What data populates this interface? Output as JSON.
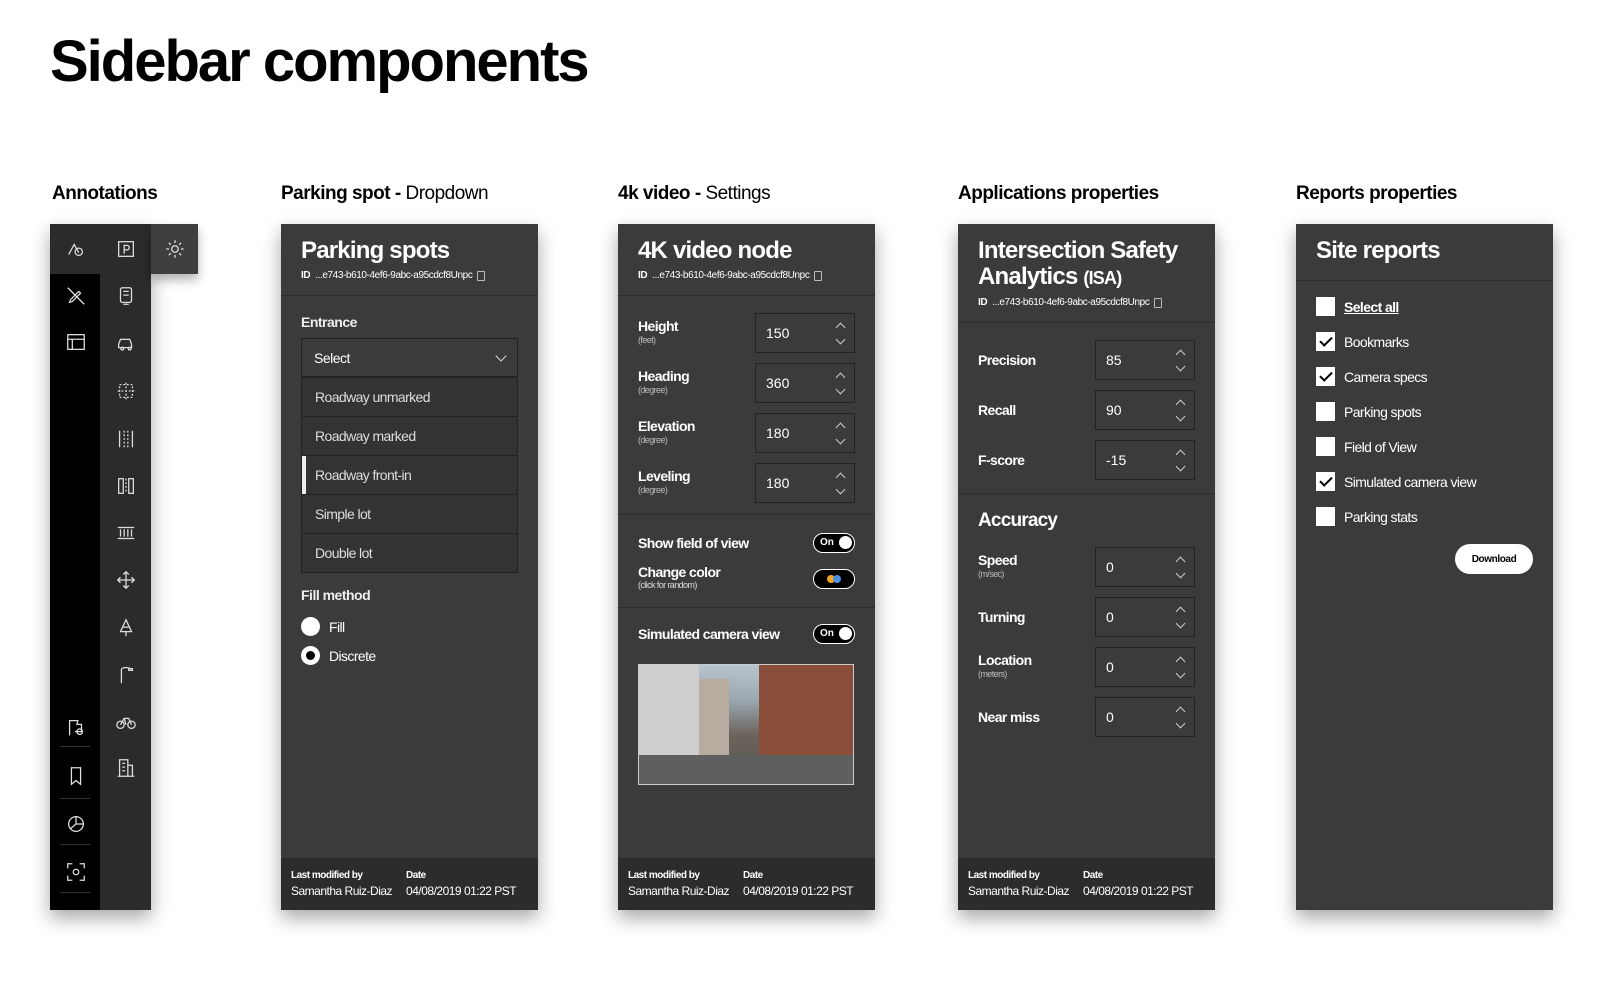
{
  "page": {
    "title": "Sidebar components"
  },
  "sections": {
    "annotations": "Annotations",
    "parking_bold": "Parking spot -",
    "parking_light": "Dropdown",
    "video_bold": "4k video -",
    "video_light": "Settings",
    "apps": "Applications properties",
    "reports": "Reports properties"
  },
  "annotations_bar": {
    "col1_icons": [
      "shapes-icon",
      "pen-off-icon",
      "layout-icon",
      "map-marker-settings-icon",
      "bookmark-icon",
      "chart-pie-icon",
      "focus-frame-icon"
    ],
    "col2_icons": [
      "parking-icon",
      "sign-icon",
      "car-icon",
      "dashed-box-icon",
      "lanes-icon",
      "lane-divider-icon",
      "crosswalk-icon",
      "move-icon",
      "tree-icon",
      "streetlight-icon",
      "bicycle-icon",
      "building-icon"
    ],
    "gear_icon": "gear-icon"
  },
  "parking": {
    "title": "Parking spots",
    "id_label": "ID",
    "id_value": "...e743-b610-4ef6-9abc-a95cdcf8Unpc",
    "entrance_label": "Entrance",
    "select_value": "Select",
    "options": [
      "Roadway unmarked",
      "Roadway marked",
      "Roadway front-in",
      "Simple lot",
      "Double lot"
    ],
    "active_option_index": 2,
    "fill_label": "Fill method",
    "radios": [
      {
        "label": "Fill",
        "checked": false
      },
      {
        "label": "Discrete",
        "checked": true
      }
    ]
  },
  "video": {
    "title": "4K video node",
    "id_label": "ID",
    "id_value": "...e743-b610-4ef6-9abc-a95cdcf8Unpc",
    "fields": [
      {
        "label": "Height",
        "unit": "(feet)",
        "value": "150"
      },
      {
        "label": "Heading",
        "unit": "(degree)",
        "value": "360"
      },
      {
        "label": "Elevation",
        "unit": "(degree)",
        "value": "180"
      },
      {
        "label": "Leveling",
        "unit": "(degree)",
        "value": "180"
      }
    ],
    "show_fov_label": "Show field of view",
    "show_fov_state": "On",
    "change_color_label": "Change color",
    "change_color_hint": "(click for random)",
    "sim_label": "Simulated camera view",
    "sim_state": "On"
  },
  "apps": {
    "title_line1": "Intersection Safety",
    "title_line2": "Analytics",
    "title_suffix": "(ISA)",
    "id_label": "ID",
    "id_value": "...e743-b610-4ef6-9abc-a95cdcf8Unpc",
    "fields": [
      {
        "label": "Precision",
        "value": "85"
      },
      {
        "label": "Recall",
        "value": "90"
      },
      {
        "label": "F-score",
        "value": "-15"
      }
    ],
    "accuracy_title": "Accuracy",
    "accuracy_fields": [
      {
        "label": "Speed",
        "unit": "(m/sec)",
        "value": "0"
      },
      {
        "label": "Turning",
        "unit": "",
        "value": "0"
      },
      {
        "label": "Location",
        "unit": "(meters)",
        "value": "0"
      },
      {
        "label": "Near miss",
        "unit": "",
        "value": "0"
      }
    ]
  },
  "reports": {
    "title": "Site reports",
    "items": [
      {
        "label": "Select all",
        "checked": false
      },
      {
        "label": "Bookmarks",
        "checked": true
      },
      {
        "label": "Camera specs",
        "checked": true
      },
      {
        "label": "Parking spots",
        "checked": false
      },
      {
        "label": "Field of View",
        "checked": false
      },
      {
        "label": "Simulated camera view",
        "checked": true
      },
      {
        "label": "Parking stats",
        "checked": false
      }
    ],
    "download": "Download"
  },
  "footer": {
    "modified_label": "Last modified by",
    "modified_value": "Samantha Ruiz-Diaz",
    "date_label": "Date",
    "date_value": "04/08/2019  01:22 PST"
  }
}
